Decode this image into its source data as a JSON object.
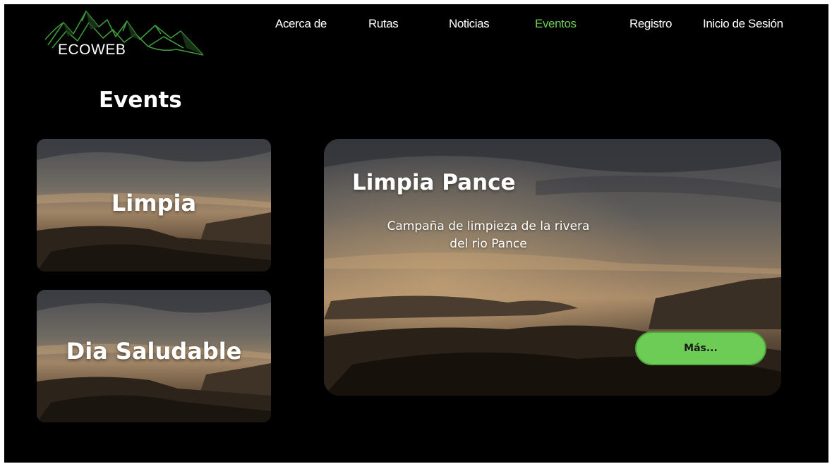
{
  "brand": {
    "name": "ECOWEB",
    "logo_icon": "mountains-icon",
    "logo_color": "#3f9a3a"
  },
  "nav": {
    "items": [
      {
        "label": "Acerca de",
        "active": false
      },
      {
        "label": "Rutas",
        "active": false
      },
      {
        "label": "Noticias",
        "active": false
      },
      {
        "label": "Eventos",
        "active": true
      },
      {
        "label": "Registro",
        "active": false
      },
      {
        "label": "Inicio de Sesión",
        "active": false
      }
    ],
    "active_color": "#6dcc55"
  },
  "page": {
    "title": "Events"
  },
  "events": {
    "list": [
      {
        "label": "Limpia"
      },
      {
        "label": "Dia Saludable"
      }
    ],
    "featured": {
      "title": "Limpia Pance",
      "description": "Campaña de limpieza de la rivera del rio Pance",
      "button_label": "Más...",
      "button_color": "#6dcc55"
    }
  },
  "colors": {
    "background": "#000000",
    "text": "#ffffff",
    "accent": "#6dcc55"
  }
}
